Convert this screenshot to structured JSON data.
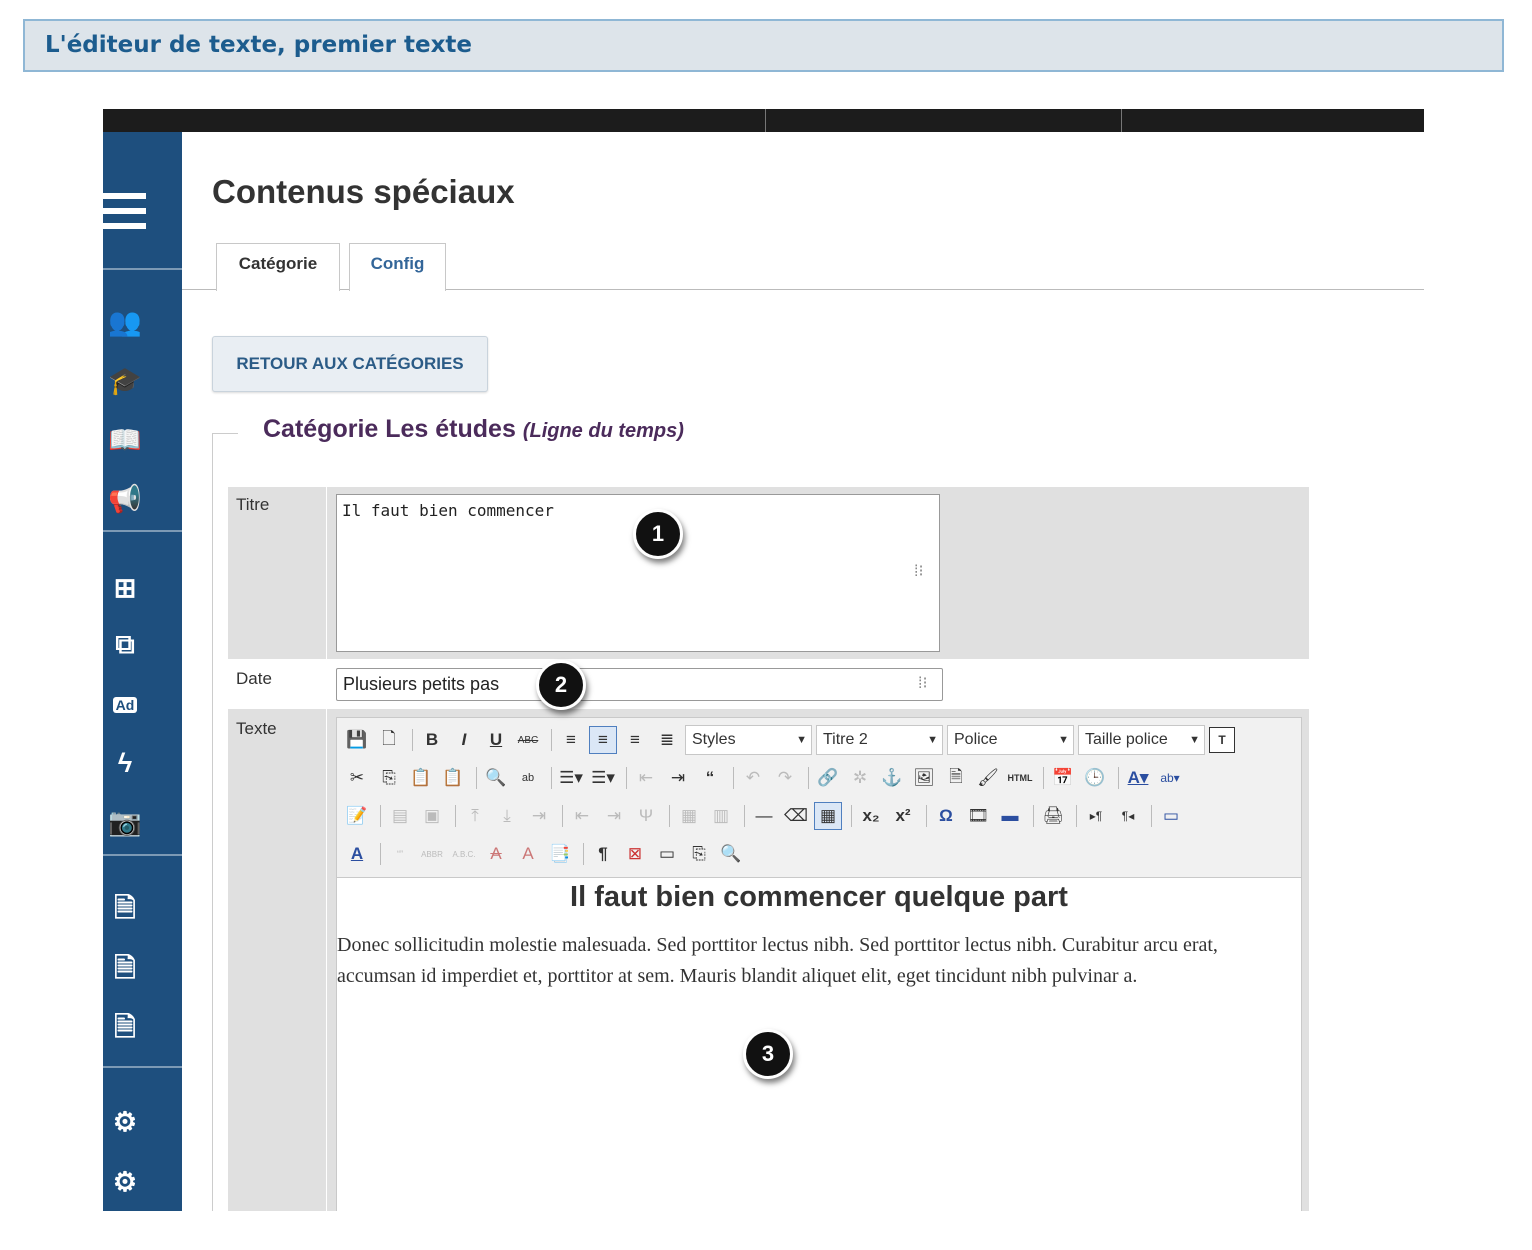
{
  "banner": {
    "title": "L'éditeur de texte, premier texte"
  },
  "page": {
    "title": "Contenus spéciaux"
  },
  "tabs": [
    {
      "label": "Catégorie",
      "active": true
    },
    {
      "label": "Config",
      "active": false
    }
  ],
  "back_button": {
    "label": "RETOUR AUX CATÉGORIES"
  },
  "category": {
    "heading": "Catégorie Les études",
    "subheading": "(Ligne du temps)"
  },
  "form": {
    "titre": {
      "label": "Titre",
      "value": "Il faut bien commencer"
    },
    "date": {
      "label": "Date",
      "value": "Plusieurs petits pas"
    },
    "texte": {
      "label": "Texte"
    }
  },
  "editor": {
    "styles_select": "Styles",
    "format_select": "Titre 2",
    "font_select": "Police",
    "size_select": "Taille police",
    "content_heading": "Il faut bien commencer quelque part",
    "content_paragraph": "Donec sollicitudin molestie malesuada. Sed porttitor lectus nibh. Sed porttitor lectus nibh. Curabitur arcu erat, accumsan id imperdiet et, porttitor at sem. Mauris blandit aliquet elit, eget tincidunt nibh pulvinar a."
  },
  "callouts": [
    "1",
    "2",
    "3"
  ],
  "sidebar_icons": [
    "menu-icon",
    "users-icon",
    "graduation-cap-icon",
    "book-icon",
    "megaphone-icon",
    "sitemap-icon",
    "copy-icon",
    "ad-icon",
    "bolt-icon",
    "camera-icon",
    "invoice-icon",
    "invoice-icon",
    "invoice-icon",
    "cogs-icon",
    "cogs-icon"
  ],
  "colors": {
    "sidebar": "#1e4f7e",
    "banner_bg": "#dde4ea",
    "banner_border": "#8fb7d5",
    "legend": "#4b2b5b"
  }
}
